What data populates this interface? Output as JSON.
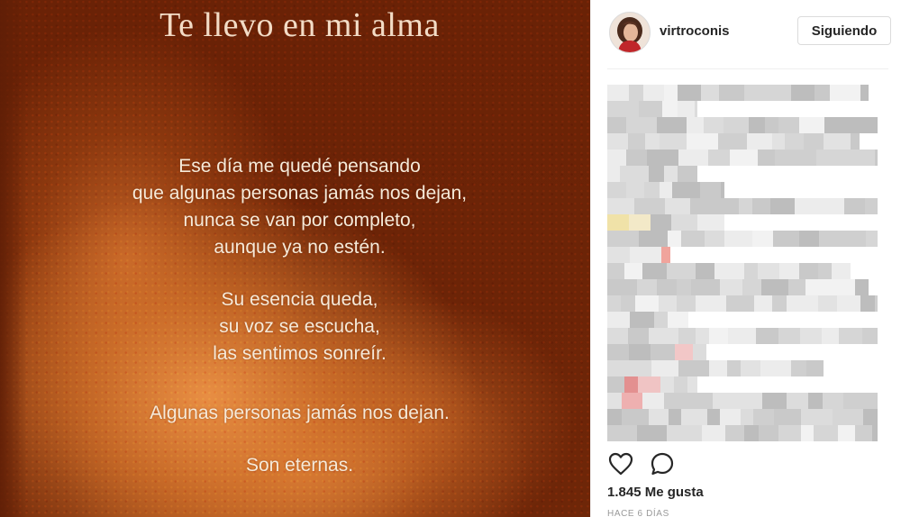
{
  "post": {
    "image": {
      "title": "Te llevo en mi alma",
      "stanzas": [
        [
          "Ese día me quedé pensando",
          "que algunas personas jamás nos dejan,",
          "nunca se van por completo,",
          "aunque ya no estén."
        ],
        [
          "Su esencia queda,",
          "su voz se escucha,",
          "las sentimos sonreír."
        ],
        [
          "Algunas personas jamás nos dejan."
        ],
        [
          "Son eternas."
        ]
      ]
    },
    "header": {
      "username": "virtroconis",
      "follow_label": "Siguiendo"
    },
    "comments_pixelated": true,
    "likes_text": "1.845 Me gusta",
    "timestamp": "Hace 6 días"
  },
  "colors": {
    "image_background": "#6b2406",
    "image_glow": "#e2914a",
    "poem_text": "#f6ead9",
    "panel_text": "#262626",
    "muted_text": "#999999",
    "border": "#dbdbdb"
  },
  "icons": {
    "like": "heart-outline-icon",
    "comment": "speech-bubble-icon"
  }
}
